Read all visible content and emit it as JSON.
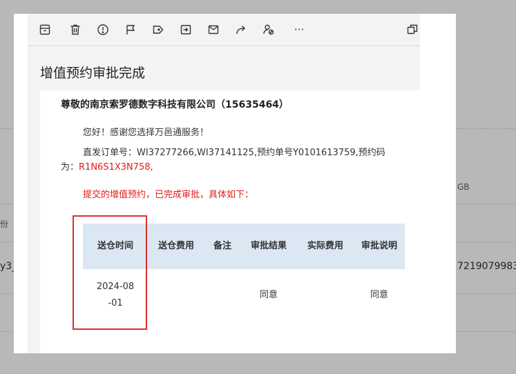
{
  "background": {
    "top_line": "",
    "right_size_fragment": "GB",
    "left_fragment_1": "份",
    "left_fragment_2": "y3_",
    "right_number_fragment": "7219079983"
  },
  "toolbar": {
    "icons": [
      "archive-icon",
      "delete-icon",
      "report-icon",
      "flag-icon",
      "tag-icon",
      "move-icon",
      "mark-read-icon",
      "forward-icon",
      "assign-icon",
      "more-icon",
      "popout-icon"
    ],
    "more_label": "···"
  },
  "mail": {
    "subject": "增值预约审批完成",
    "company": "尊敬的南京索罗德数字科技有限公司（15635464）",
    "greeting": "您好！感谢您选择万邑通服务！",
    "order_prefix": "直发订单号：WI37277266,WI37141125,预约单号Y0101613759,预约码为：",
    "reservation_code": "R1N6S1X3N758,",
    "notice": "提交的增值预约，已完成审批，具体如下："
  },
  "table": {
    "headers": [
      "送仓时间",
      "送仓费用",
      "备注",
      "审批结果",
      "实际费用",
      "审批说明"
    ],
    "rows": [
      [
        "2024-08-01",
        "",
        "",
        "同意",
        "",
        "同意"
      ]
    ]
  },
  "colors": {
    "accent_red": "#e01b1b",
    "header_blue": "#dbe7f3",
    "highlight_border": "#d9302a"
  }
}
